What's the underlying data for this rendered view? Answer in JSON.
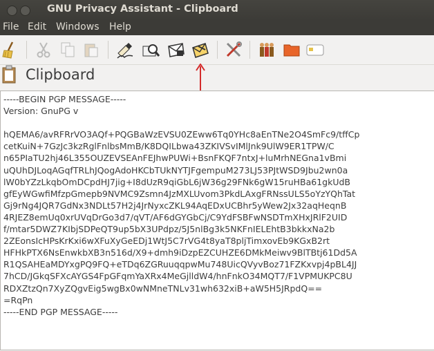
{
  "window": {
    "title": "GNU Privacy Assistant - Clipboard"
  },
  "menu": {
    "file": "File",
    "edit": "Edit",
    "windows": "Windows",
    "help": "Help"
  },
  "toolbar": {
    "icons": [
      "broom-icon",
      "cut-icon",
      "copy-icon",
      "paste-icon",
      "sign-icon",
      "verify-icon",
      "encrypt-icon",
      "decrypt-icon",
      "settings-icon",
      "keyring-icon",
      "files-icon",
      "card-icon"
    ]
  },
  "header": {
    "title": "Clipboard"
  },
  "editor": {
    "lines": [
      "-----BEGIN PGP MESSAGE-----",
      "Version: GnuPG v",
      "",
      "hQEMA6/avRFRrVO3AQf+PQGBaWzEVSU0ZEww6Tq0YHc8aEnTNe2O4SmFc9/tffCp",
      "cetKuiN+7GzJc3kzRglFnlbsMmB/K8DQILbwa43ZKIVSvIMlJnk9UlW9ER1TPW/C",
      "n65PIaTU2hj46L355OUZEVSEAnFEJhwPUWi+BsnFKQF7ntxJ+luMrhNEGna1vBmi",
      "uQUhDJLoqAGqfTRLhJQogAdoHKCbTUkNYTJFgempuM273LJ53PJtWSD9Jbu2wn0a",
      "lW0bYZzLkqbOmDCpdHJ7jig+I8dUzR9qiGbL6jW36g29FNk6gW15ruHBa61gkUdB",
      "gfEyWGwfiMfzpGmepb9NVMC9Zsmn4JzMXLUvom3PkdLAxgFRNssULS5oYzYQhTat",
      "Gj9rNg4JQR7GdNx3NDLt57H2j4JrNyxcZKL94AqEDxUCBhr5yWew2Jx32aqHeqnB",
      "4RJEZ8emUq0xrUVqDrGo3d7/qVT/AF6dGYGbCj/C9YdFSBFwNSDTmXHxJRlF2UID",
      "f/mtar5DWZ7KIbjSDPeQT9up5bX3UPdpz/5J5nlBg3k5NKFnIELEhtB3bkkxNa2b",
      "2ZEonsIcHPsKrKxi6wXFuXyGeEDj1WtJ5C7rVG4t8yaT8pljTimxovEb9KGxB2rt",
      "HFHkPTX6NsEnwkbXB3n516d/X9+dmh9iDzpEZCUHZE6DMkMeiwv9BlTBtj61Dd5A",
      "R1QSAHEaMDYxgPQ9FQ+eTDq6ZGRuuqqpwMu748UicQVyvBoz71FZKxvpj4pBL4JJ",
      "7hCD/JGkqSFXcAYGS4FpGFqmYaXRx4MeGjlldW4/hnFnkO34MQT7/F1VPMUKPC8U",
      "RDXZtzQn7XyZQgvEig5wgBx0wNMneTNLv31wh632xiB+aW5H5JRpdQ==",
      "=RqPn",
      "-----END PGP MESSAGE-----"
    ]
  }
}
